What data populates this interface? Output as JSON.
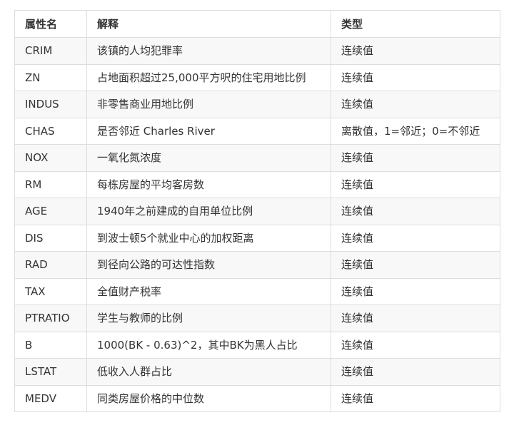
{
  "table": {
    "headers": [
      "属性名",
      "解释",
      "类型"
    ],
    "rows": [
      {
        "name": "CRIM",
        "desc": "该镇的人均犯罪率",
        "type": "连续值"
      },
      {
        "name": "ZN",
        "desc": "占地面积超过25,000平方呎的住宅用地比例",
        "type": "连续值"
      },
      {
        "name": "INDUS",
        "desc": "非零售商业用地比例",
        "type": "连续值"
      },
      {
        "name": "CHAS",
        "desc": "是否邻近 Charles River",
        "type": "离散值，1=邻近；0=不邻近"
      },
      {
        "name": "NOX",
        "desc": "一氧化氮浓度",
        "type": "连续值"
      },
      {
        "name": "RM",
        "desc": "每栋房屋的平均客房数",
        "type": "连续值"
      },
      {
        "name": "AGE",
        "desc": "1940年之前建成的自用单位比例",
        "type": "连续值"
      },
      {
        "name": "DIS",
        "desc": "到波士顿5个就业中心的加权距离",
        "type": "连续值"
      },
      {
        "name": "RAD",
        "desc": "到径向公路的可达性指数",
        "type": "连续值"
      },
      {
        "name": "TAX",
        "desc": "全值财产税率",
        "type": "连续值"
      },
      {
        "name": "PTRATIO",
        "desc": "学生与教师的比例",
        "type": "连续值"
      },
      {
        "name": "B",
        "desc": "1000(BK - 0.63)^2，其中BK为黑人占比",
        "type": "连续值"
      },
      {
        "name": "LSTAT",
        "desc": "低收入人群占比",
        "type": "连续值"
      },
      {
        "name": "MEDV",
        "desc": "同类房屋价格的中位数",
        "type": "连续值"
      }
    ]
  }
}
